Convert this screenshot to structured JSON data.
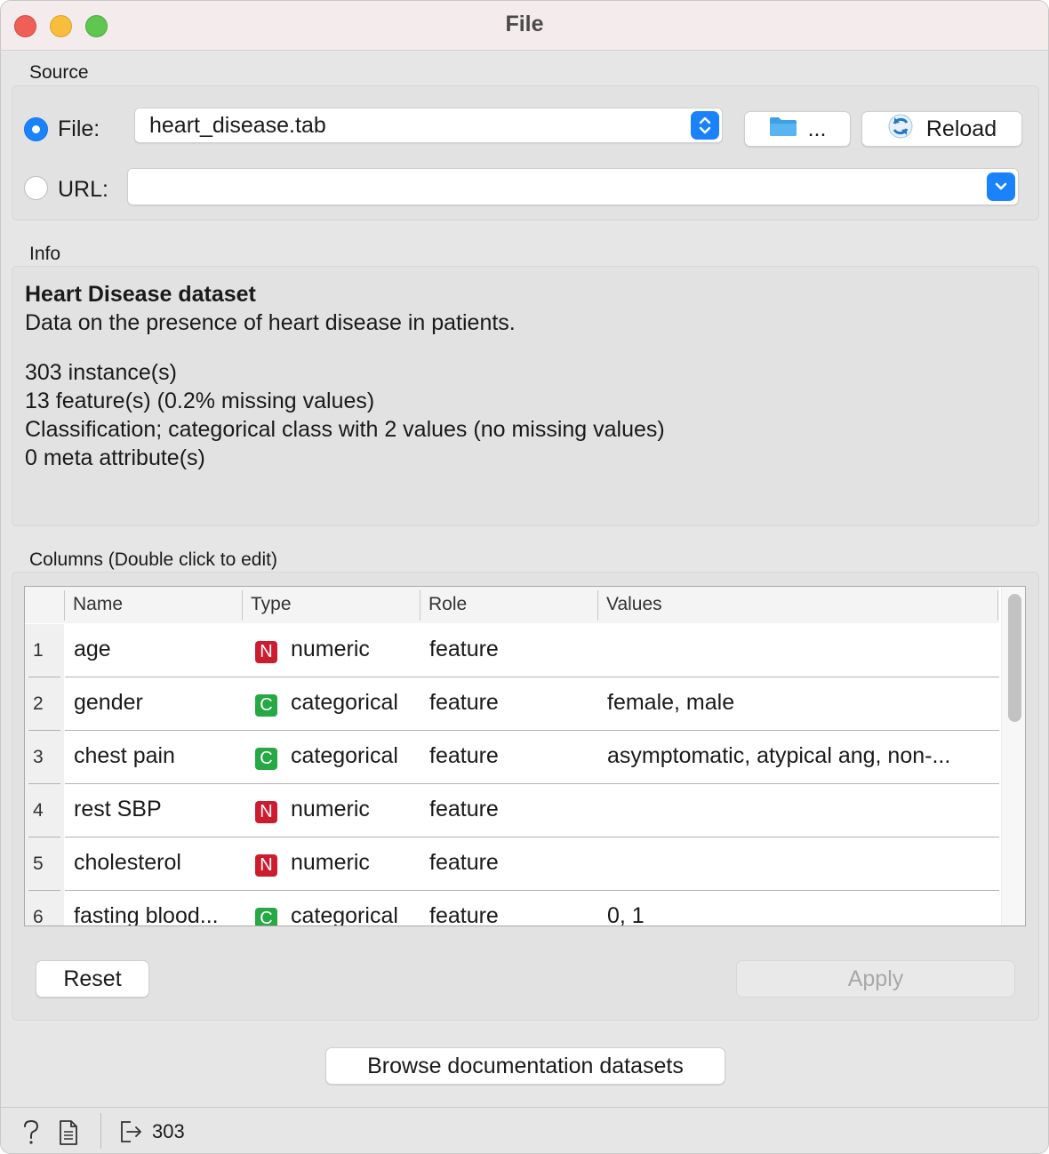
{
  "window": {
    "title": "File"
  },
  "source": {
    "label": "Source",
    "file_option_label": "File:",
    "file_value": "heart_disease.tab",
    "browse_button_label": "...",
    "reload_button_label": "Reload",
    "url_option_label": "URL:",
    "url_value": "",
    "selected_option": "file"
  },
  "info": {
    "label": "Info",
    "dataset_title": "Heart Disease dataset",
    "description": "Data on the presence of heart disease in patients.",
    "instances": "303 instance(s)",
    "features": "13 feature(s) (0.2% missing values)",
    "target": "Classification; categorical class with 2 values (no missing values)",
    "metas": "0 meta attribute(s)"
  },
  "columns": {
    "label": "Columns (Double click to edit)",
    "headers": [
      "Name",
      "Type",
      "Role",
      "Values"
    ],
    "rows": [
      {
        "num": "1",
        "name": "age",
        "type_badge": "N",
        "type": "numeric",
        "role": "feature",
        "values": ""
      },
      {
        "num": "2",
        "name": "gender",
        "type_badge": "C",
        "type": "categorical",
        "role": "feature",
        "values": "female, male"
      },
      {
        "num": "3",
        "name": "chest pain",
        "type_badge": "C",
        "type": "categorical",
        "role": "feature",
        "values": "asymptomatic, atypical ang, non-..."
      },
      {
        "num": "4",
        "name": "rest SBP",
        "type_badge": "N",
        "type": "numeric",
        "role": "feature",
        "values": ""
      },
      {
        "num": "5",
        "name": "cholesterol",
        "type_badge": "N",
        "type": "numeric",
        "role": "feature",
        "values": ""
      },
      {
        "num": "6",
        "name": "fasting blood...",
        "type_badge": "C",
        "type": "categorical",
        "role": "feature",
        "values": "0, 1"
      }
    ],
    "scroll_position": 0.0
  },
  "actions": {
    "reset_label": "Reset",
    "apply_label": "Apply",
    "apply_enabled": false,
    "browse_docs_label": "Browse documentation datasets"
  },
  "status": {
    "output_count": "303",
    "icons": [
      "help-icon",
      "report-icon",
      "output-icon"
    ]
  },
  "colors": {
    "accent": "#1a82fb",
    "numeric_badge": "#cc1c2e",
    "categorical_badge": "#28a745"
  }
}
